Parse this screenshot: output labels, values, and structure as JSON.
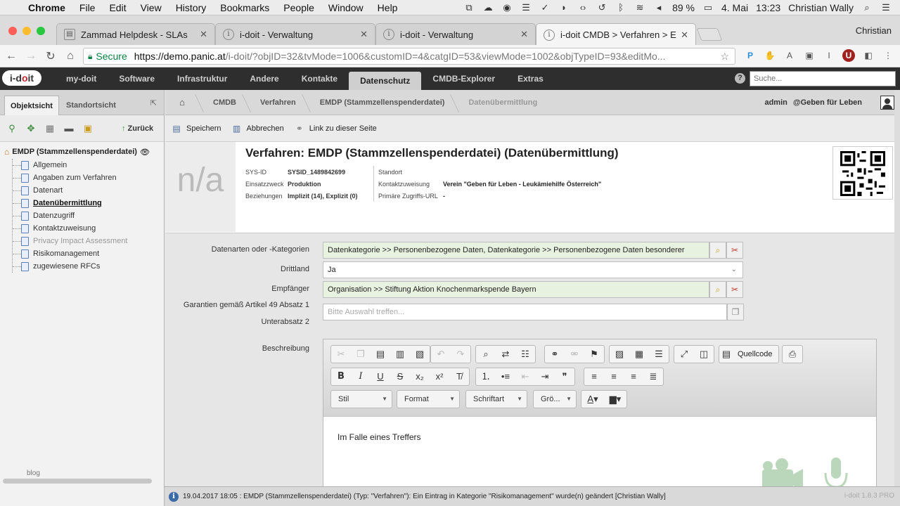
{
  "mac_menubar": {
    "app": "Chrome",
    "menus": [
      "File",
      "Edit",
      "View",
      "History",
      "Bookmarks",
      "People",
      "Window",
      "Help"
    ],
    "battery": "89 %",
    "date": "4. Mai",
    "time": "13:23",
    "user": "Christian Wally"
  },
  "chrome": {
    "tabs": [
      {
        "title": "Zammad Helpdesk - SLAs",
        "icon": "document-icon"
      },
      {
        "title": "i-doit - Verwaltung",
        "icon": "info-icon"
      },
      {
        "title": "i-doit - Verwaltung",
        "icon": "info-icon"
      },
      {
        "title": "i-doit CMDB > Verfahren > EM",
        "icon": "info-icon"
      }
    ],
    "profile": "Christian",
    "secure_label": "Secure",
    "url_host": "https://demo.panic.at",
    "url_path": "/i-doit/?objID=32&tvMode=1006&customID=4&catgID=53&viewMode=1002&objTypeID=93&editMo..."
  },
  "idoit_nav": {
    "logo": "i-doit",
    "items": [
      "my-doit",
      "Software",
      "Infrastruktur",
      "Andere",
      "Kontakte",
      "Datenschutz",
      "CMDB-Explorer",
      "Extras"
    ],
    "active": "Datenschutz",
    "search_placeholder": "Suche..."
  },
  "sidebar": {
    "tab_active": "Objektsicht",
    "tab_inactive": "Standortsicht",
    "back_label": "Zurück",
    "root": "EMDP (Stammzellenspenderdatei)",
    "items": [
      {
        "label": "Allgemein",
        "state": "normal"
      },
      {
        "label": "Angaben zum Verfahren",
        "state": "normal"
      },
      {
        "label": "Datenart",
        "state": "normal"
      },
      {
        "label": "Datenübermittlung",
        "state": "current"
      },
      {
        "label": "Datenzugriff",
        "state": "normal"
      },
      {
        "label": "Kontaktzuweisung",
        "state": "normal"
      },
      {
        "label": "Privacy Impact Assessment",
        "state": "dim"
      },
      {
        "label": "Risikomanagement",
        "state": "normal"
      },
      {
        "label": "zugewiesene RFCs",
        "state": "normal"
      }
    ],
    "footer": "blog"
  },
  "breadcrumb": {
    "items": [
      "CMDB",
      "Verfahren",
      "EMDP (Stammzellenspenderdatei)",
      "Datenübermittlung"
    ],
    "user": "admin",
    "org": "@Geben für Leben"
  },
  "actions": {
    "save": "Speichern",
    "cancel": "Abbrechen",
    "link": "Link zu dieser Seite"
  },
  "object": {
    "na": "n/a",
    "title": "Verfahren: EMDP (Stammzellenspenderdatei) (Datenübermittlung)",
    "sysid_label": "SYS-ID",
    "sysid": "SYSID_1489842699",
    "einsatz_label": "Einsatzzweck",
    "einsatz": "Produktion",
    "bez_label": "Beziehungen",
    "bez": "Implizit (14), Explizit (0)",
    "standort_label": "Standort",
    "standort": "",
    "kontakt_label": "Kontaktzuweisung",
    "kontakt": "Verein \"Geben für Leben - Leukämiehilfe Österreich\"",
    "url_label": "Primäre Zugriffs-URL",
    "url": "-"
  },
  "form": {
    "datenarten_label": "Datenarten oder -Kategorien",
    "datenarten_value": "Datenkategorie >> Personenbezogene Daten, Datenkategorie >> Personenbezogene Daten besonderer",
    "drittland_label": "Drittland",
    "drittland_value": "Ja",
    "empfaenger_label": "Empfänger",
    "empfaenger_value": "Organisation >> Stiftung Aktion Knochenmarkspende Bayern",
    "garantien_label_1": "Garantien gemäß Artikel 49 Absatz 1",
    "garantien_label_2": "Unterabsatz 2",
    "garantien_placeholder": "Bitte Auswahl treffen...",
    "beschreibung_label": "Beschreibung"
  },
  "editor": {
    "source_label": "Quellcode",
    "style": "Stil",
    "format": "Format",
    "font": "Schriftart",
    "size": "Grö...",
    "content": "Im Falle eines Treffers"
  },
  "status": {
    "message": "19.04.2017 18:05 : EMDP (Stammzellenspenderdatei) (Typ: \"Verfahren\"): Ein Eintrag in Kategorie \"Risikomanagement\" wurde(n) geändert [Christian Wally]",
    "version": "i-doit 1.8.3 PRO"
  }
}
